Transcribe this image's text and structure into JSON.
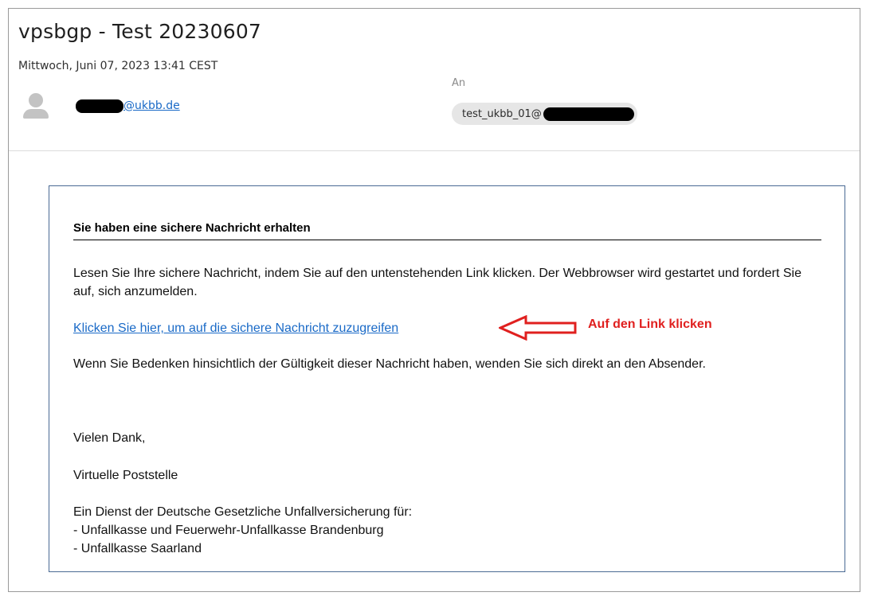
{
  "email": {
    "subject": "vpsbgp - Test 20230607",
    "date": "Mittwoch, Juni 07, 2023 13:41 CEST",
    "sender_domain": "@ukbb.de",
    "to_label": "An",
    "recipient_prefix": "test_ukbb_01@"
  },
  "message": {
    "heading": "Sie haben eine sichere Nachricht erhalten",
    "intro": "Lesen Sie Ihre sichere Nachricht, indem Sie auf den untenstehenden Link klicken. Der Webbrowser wird gestartet und fordert Sie auf, sich anzumelden.",
    "link_text": "Klicken Sie hier, um auf die sichere Nachricht zuzugreifen",
    "warning": "Wenn Sie Bedenken hinsichtlich der Gültigkeit dieser Nachricht haben, wenden Sie sich direkt an den Absender.",
    "thanks": "Vielen Dank,",
    "signature": "Virtuelle Poststelle",
    "footer_line1": "Ein Dienst der Deutsche Gesetzliche Unfallversicherung für:",
    "footer_line2": "- Unfallkasse und Feuerwehr-Unfallkasse Brandenburg",
    "footer_line3": "- Unfallkasse Saarland"
  },
  "annotation": {
    "text": "Auf den Link klicken",
    "color": "#e0201f"
  },
  "icons": {
    "avatar": "person-icon",
    "arrow": "left-arrow-icon"
  }
}
